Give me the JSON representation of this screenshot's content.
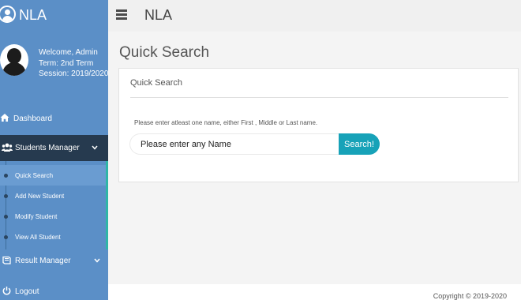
{
  "brand": {
    "name": "NLA"
  },
  "profile": {
    "welcome": "Welcome, Admin",
    "term": "Term: 2nd Term",
    "session": "Session: 2019/2020"
  },
  "sidebar": {
    "dashboard": "Dashboard",
    "students_manager": "Students Manager",
    "students_submenu": [
      "Quick Search",
      "Add New Student",
      "Modify Student",
      "View All Student"
    ],
    "result_manager": "Result Manager",
    "logout": "Logout"
  },
  "topbar": {
    "title": "NLA"
  },
  "main": {
    "page_title": "Quick Search",
    "panel_title": "Quick Search",
    "hint": "Please enter atleast one name, either First , Middle or Last name.",
    "search_placeholder": "Please enter any Name",
    "search_button": "Search!"
  },
  "footer": {
    "copyright": "Copyright © 2019-2020"
  },
  "colors": {
    "sidebar": "#5b8fc7",
    "sidebar_active": "#263a4f",
    "accent": "#17a2b8"
  },
  "icons": [
    "user-circle-icon",
    "home-icon",
    "users-icon",
    "chevron-down-icon",
    "book-icon",
    "power-icon",
    "hamburger-icon"
  ]
}
